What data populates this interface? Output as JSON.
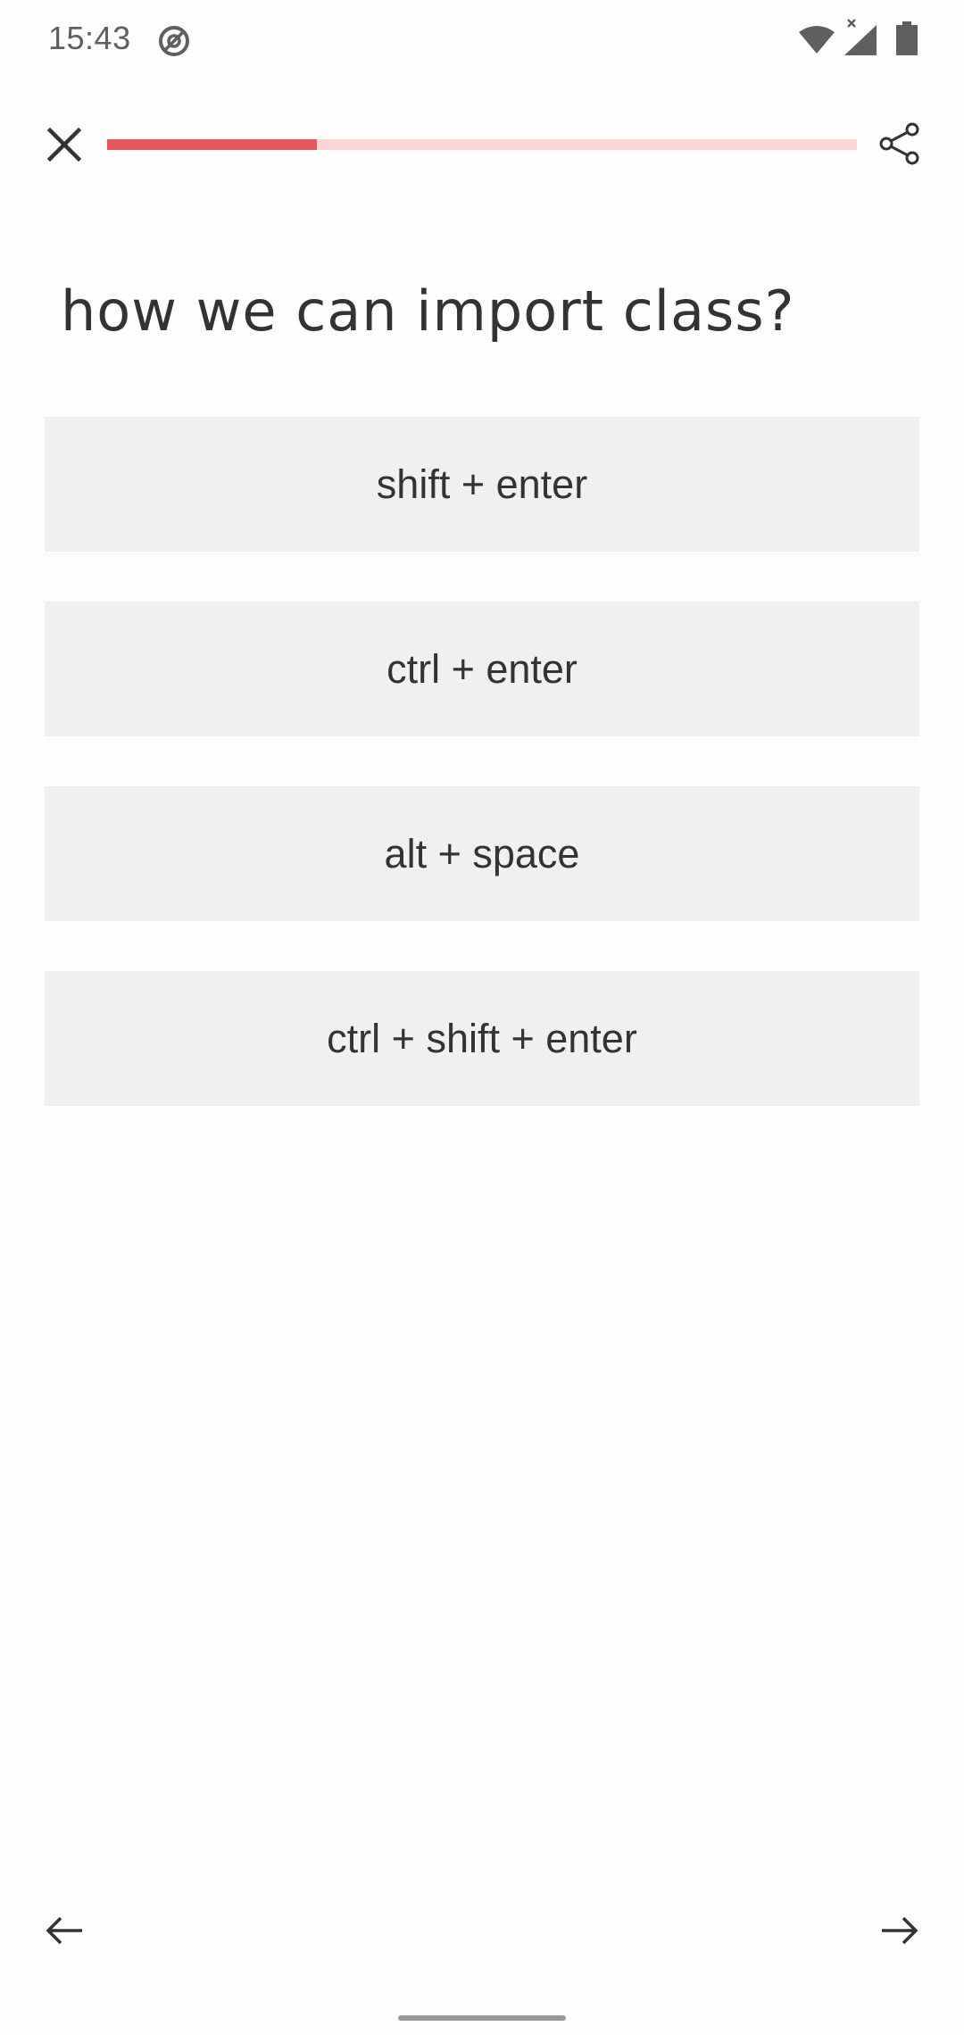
{
  "status_bar": {
    "time": "15:43",
    "icons": [
      "sync-icon",
      "wifi-icon",
      "signal-icon",
      "battery-icon"
    ]
  },
  "top_bar": {
    "close_icon": "close-icon",
    "share_icon": "share-icon",
    "progress": 0.28,
    "progress_color": "#e8595f",
    "progress_track_color": "#fbd4d6"
  },
  "question": {
    "text": "how we can import class?"
  },
  "options": [
    {
      "label": "shift + enter"
    },
    {
      "label": "ctrl + enter"
    },
    {
      "label": "alt + space"
    },
    {
      "label": "ctrl + shift + enter"
    }
  ],
  "navigation": {
    "prev_icon": "arrow-left-icon",
    "next_icon": "arrow-right-icon"
  }
}
